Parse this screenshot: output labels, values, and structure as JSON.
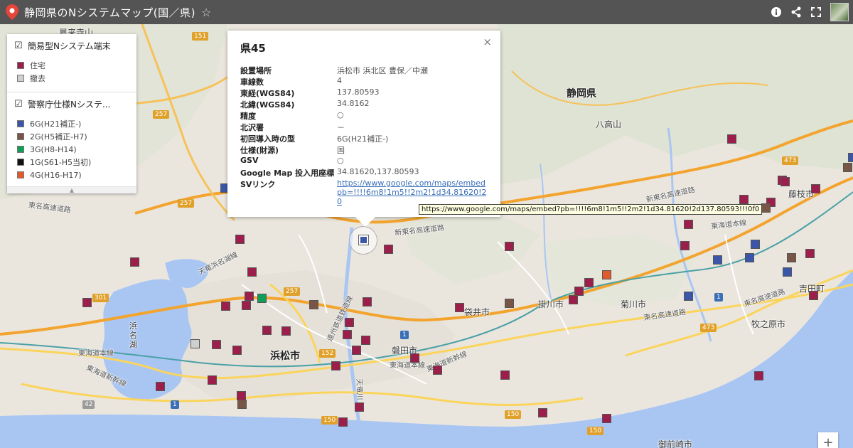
{
  "header": {
    "title": "静岡県のNシステムマップ(国／県)"
  },
  "legend": {
    "layers": [
      {
        "name": "簡易型Nシステム端末",
        "items": [
          {
            "label": "住宅",
            "color": "#9c1e4a"
          },
          {
            "label": "撤去",
            "color": "#cfcfcf"
          }
        ]
      },
      {
        "name": "警察庁仕様Nシステ...",
        "items": [
          {
            "label": "6G(H21補正-)",
            "color": "#3b55a8"
          },
          {
            "label": "2G(H5補正-H7)",
            "color": "#795548"
          },
          {
            "label": "3G(H8-H14)",
            "color": "#0f9d58"
          },
          {
            "label": "1G(S61-H5当初)",
            "color": "#111111"
          },
          {
            "label": "4G(H16-H17)",
            "color": "#e05a2b"
          }
        ]
      }
    ]
  },
  "info": {
    "title": "県45",
    "fields": [
      {
        "key": "設置場所",
        "value": "浜松市 浜北区 豊保／中瀬"
      },
      {
        "key": "車線数",
        "value": "4"
      },
      {
        "key": "東経(WGS84)",
        "value": "137.80593"
      },
      {
        "key": "北緯(WGS84)",
        "value": "34.8162"
      },
      {
        "key": "精度",
        "value": "○"
      },
      {
        "key": "北沢署",
        "value": "－"
      },
      {
        "key": "初回導入時の型",
        "value": "6G(H21補正-)"
      },
      {
        "key": "仕様(財源)",
        "value": "国"
      },
      {
        "key": "GSV",
        "value": "○"
      },
      {
        "key": "Google Map 投入用座標",
        "value": "34.81620,137.80593"
      }
    ],
    "link_key": "SVリンク",
    "link_lines": [
      "https://www.google.com/maps/embed",
      "pb=!!!!6m8!1m5!!2m2!1d34.81620!2d137",
      "0"
    ],
    "close": "×"
  },
  "tooltip": "https://www.google.com/maps/embed?pb=!!!!6m8!1m5!!2m2!1d34.81620!2d137.80593!!!0f0",
  "map_labels": {
    "shizuoka_ken": "静岡県",
    "yatakayama": "八高山",
    "fujieda": "藤枝市",
    "hamamatsu": "浜松市",
    "iwata": "磐田市",
    "fukuroi": "袋井市",
    "kakegawa": "掛川市",
    "kikugawa": "菊川市",
    "yoshida": "吉田町",
    "makinohara": "牧之原市",
    "omaezaki": "御前崎市",
    "hamanako": "浜名湖",
    "kurumagi": "鳳来寺山",
    "tomei1": "東名高速道路",
    "tomei2": "東名高速道路",
    "tomei3": "東名高速道路",
    "shintomei1": "新東名高速道路",
    "shintomei2": "新東名高速道路",
    "tokaido_line1": "東海道本線",
    "tokaido_line2": "東海道本線",
    "tokaido_line3": "東海道本線",
    "shinkansen1": "東海道新幹線",
    "shinkansen2": "東海道新幹線",
    "tenryu": "天竜浜名湖線",
    "enshu": "遠州鉄道鉄道線",
    "tenryu_river": "天竜川"
  },
  "shields": [
    "151",
    "257",
    "257",
    "301",
    "257",
    "152",
    "1",
    "1",
    "150",
    "150",
    "42",
    "1",
    "473",
    "473",
    "150"
  ],
  "markers": [
    {
      "type": "住宅",
      "color": "#9c1e4a"
    },
    {
      "type": "6G(H21補正-)",
      "color": "#3b55a8"
    },
    {
      "type": "2G(H5補正-H7)",
      "color": "#795548"
    },
    {
      "type": "3G(H8-H14)",
      "color": "#0f9d58"
    },
    {
      "type": "4G(H16-H17)",
      "color": "#e05a2b"
    },
    {
      "type": "撤去",
      "color": "#cfcfcf"
    }
  ]
}
